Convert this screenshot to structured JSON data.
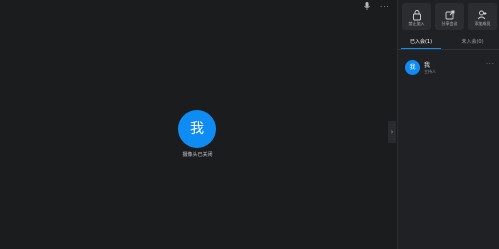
{
  "main": {
    "controls": {
      "mic_icon": "microphone-icon",
      "more_icon": "more-icon",
      "more_glyph": "···"
    },
    "self_avatar_text": "我",
    "camera_status": "摄像头已关闭"
  },
  "panel": {
    "collapse_glyph": "›",
    "actions": [
      {
        "icon": "lock-icon",
        "label": "禁止加入"
      },
      {
        "icon": "share-icon",
        "label": "分享会议"
      },
      {
        "icon": "add-user-icon",
        "label": "添加成员"
      }
    ],
    "tabs": [
      {
        "label": "已入会(1)",
        "active": true
      },
      {
        "label": "未入会(0)",
        "active": false
      }
    ],
    "members": [
      {
        "avatar_text": "我",
        "name": "我",
        "role": "主持人",
        "more_glyph": "···"
      }
    ]
  },
  "colors": {
    "accent": "#0e8cf4",
    "background": "#1b1c1e",
    "panel": "#202124"
  }
}
